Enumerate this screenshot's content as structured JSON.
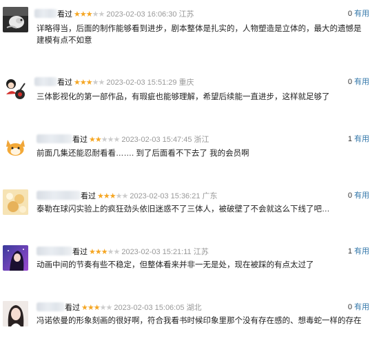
{
  "comments": [
    {
      "action": "看过",
      "rating": 3,
      "time": "2023-02-03 16:06:30",
      "location": "江苏",
      "votes": "0",
      "useful_label": "有用",
      "text": "详略得当，后面的制作能够看到进步，剧本整体是扎实的，人物塑造是立体的，最大的遗憾是建模有点不如意"
    },
    {
      "action": "看过",
      "rating": 3,
      "time": "2023-02-03 15:51:29",
      "location": "重庆",
      "votes": "0",
      "useful_label": "有用",
      "text": "三体影视化的第一部作品，有瑕疵也能够理解，希望后续能一直进步，这样就足够了"
    },
    {
      "action": "看过",
      "rating": 2,
      "time": "2023-02-03 15:47:45",
      "location": "浙江",
      "votes": "1",
      "useful_label": "有用",
      "text": "前面几集还能忍耐看看……. 到了后面看不下去了 我的会员啊"
    },
    {
      "action": "看过",
      "rating": 3,
      "time": "2023-02-03 15:36:21",
      "location": "广东",
      "votes": "0",
      "useful_label": "有用",
      "text": "泰勒在球闪实验上的疯狂劲头依旧迷惑不了三体人，被破壁了不会就这么下线了吧…"
    },
    {
      "action": "看过",
      "rating": 3,
      "time": "2023-02-03 15:21:11",
      "location": "江苏",
      "votes": "1",
      "useful_label": "有用",
      "text": "动画中间的节奏有些不稳定，但整体看来并非一无是处，现在被踩的有点太过了"
    },
    {
      "action": "看过",
      "rating": 3,
      "time": "2023-02-03 15:06:05",
      "location": "湖北",
      "votes": "0",
      "useful_label": "有用",
      "text": "冯诺依曼的形象刻画的很好啊，符合我看书时候印象里那个没有存在感的、想毒蛇一样的存在"
    }
  ]
}
